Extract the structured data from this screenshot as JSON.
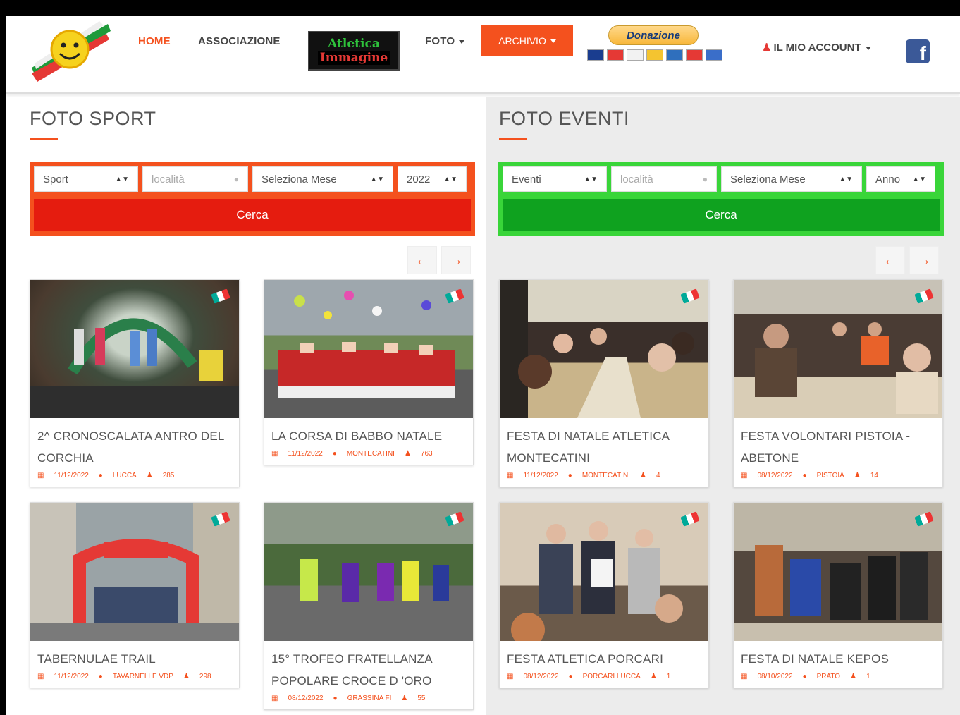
{
  "nav": {
    "home": "HOME",
    "associazione": "ASSOCIAZIONE",
    "banner_line1": "Atletica",
    "banner_line2": "Immagine",
    "foto": "FOTO",
    "archivio": "ARCHIVIO",
    "donazione": "Donazione",
    "account": "IL MIO ACCOUNT",
    "facebook": "f"
  },
  "sport": {
    "title": "FOTO SPORT",
    "select_category": "Sport",
    "location_placeholder": "località",
    "select_month": "Seleziona Mese",
    "select_year": "2022",
    "search_button": "Cerca",
    "prev": "←",
    "next": "→",
    "cards": [
      {
        "title": "2^ CRONOSCALATA ANTRO DEL CORCHIA",
        "date": "11/12/2022",
        "place": "LUCCA",
        "count": "285"
      },
      {
        "title": "LA CORSA DI BABBO NATALE",
        "date": "11/12/2022",
        "place": "MONTECATINI",
        "count": "763"
      },
      {
        "title": "TABERNULAE TRAIL",
        "date": "11/12/2022",
        "place": "TAVARNELLE VDP",
        "count": "298"
      },
      {
        "title": "15° TROFEO FRATELLANZA POPOLARE CROCE D 'ORO",
        "date": "08/12/2022",
        "place": "GRASSINA FI",
        "count": "55"
      }
    ]
  },
  "eventi": {
    "title": "FOTO EVENTI",
    "select_category": "Eventi",
    "location_placeholder": "località",
    "select_month": "Seleziona Mese",
    "select_year": "Anno",
    "search_button": "Cerca",
    "prev": "←",
    "next": "→",
    "cards": [
      {
        "title": "FESTA DI NATALE ATLETICA MONTECATINI",
        "date": "11/12/2022",
        "place": "MONTECATINI",
        "count": "4"
      },
      {
        "title": "FESTA VOLONTARI PISTOIA - ABETONE",
        "date": "08/12/2022",
        "place": "PISTOIA",
        "count": "14"
      },
      {
        "title": "FESTA ATLETICA PORCARI",
        "date": "08/12/2022",
        "place": "PORCARI LUCCA",
        "count": "1"
      },
      {
        "title": "FESTA DI NATALE KEPOS",
        "date": "08/10/2022",
        "place": "PRATO",
        "count": "1"
      }
    ]
  },
  "colors": {
    "accent": "#f4511e",
    "sport_button": "#e51c0f",
    "eventi_frame": "#39d539",
    "eventi_button": "#0fa21f",
    "facebook": "#3b5998"
  }
}
